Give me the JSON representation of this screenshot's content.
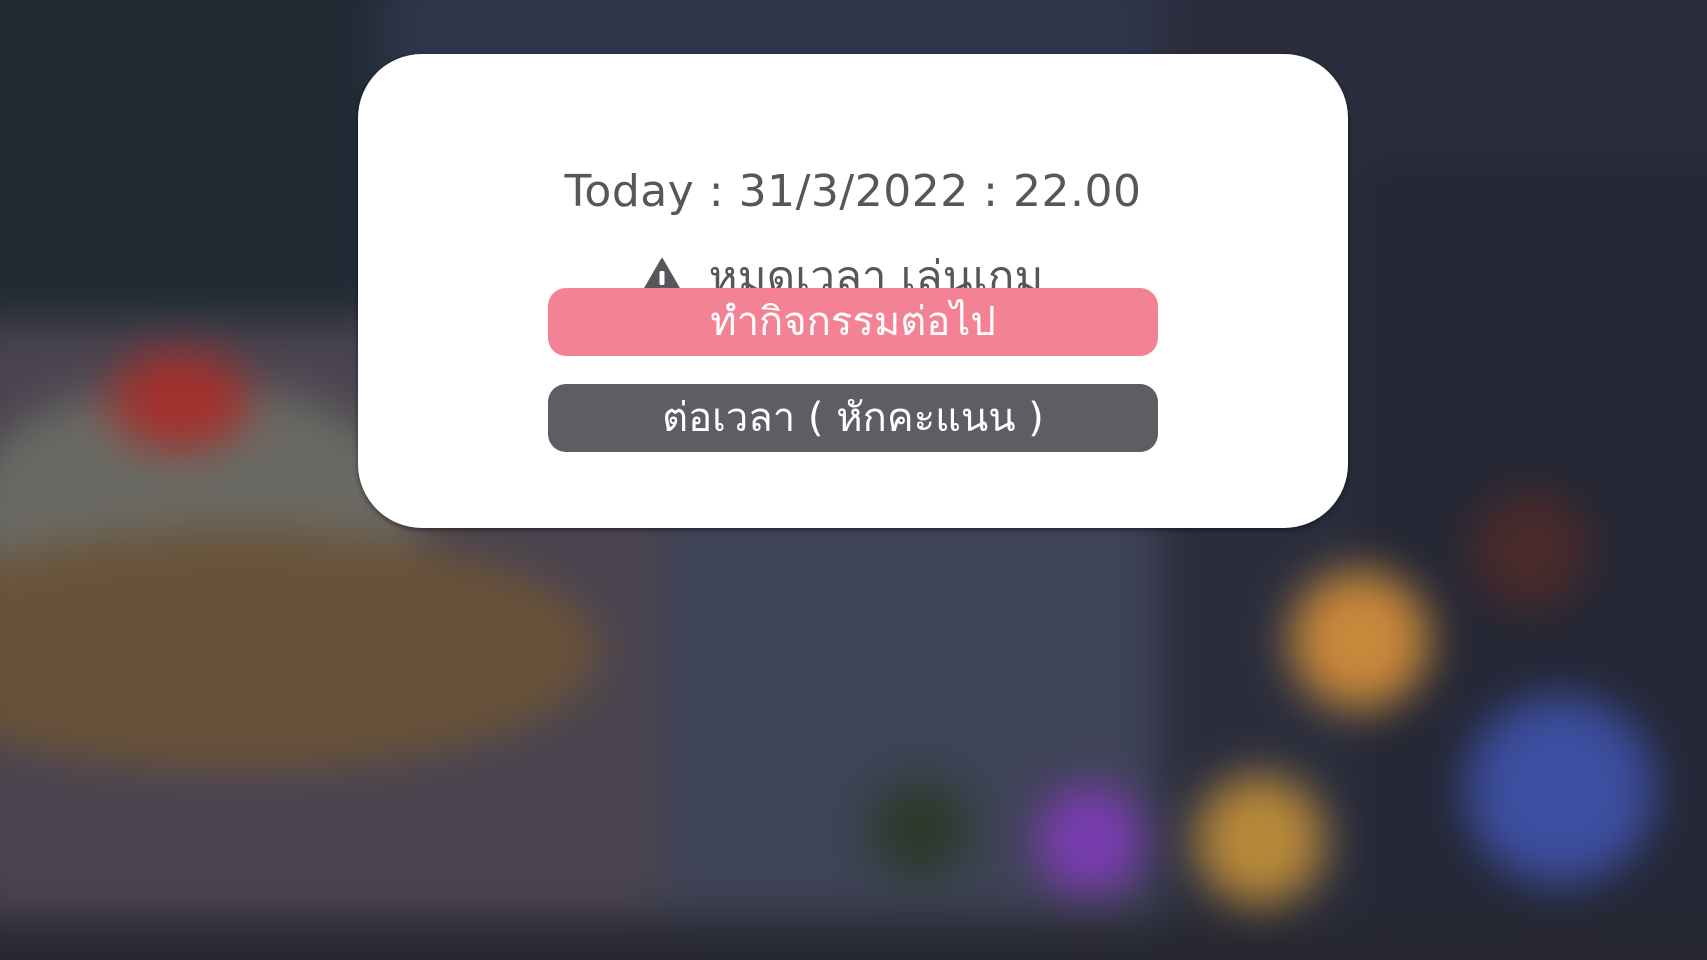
{
  "dialog": {
    "date_line": "Today : 31/3/2022 : 22.00",
    "warning_icon": "warning-triangle-icon",
    "warning_text": "หมดเวลา เล่นเกม",
    "continue_label": "ทำกิจกรรมต่อไป",
    "extend_label": "ต่อเวลา ( หักคะแนน )"
  },
  "colors": {
    "primary_button": "#f48295",
    "secondary_button": "#5d5d63",
    "text": "#57575b",
    "dialog_bg": "#ffffff"
  }
}
